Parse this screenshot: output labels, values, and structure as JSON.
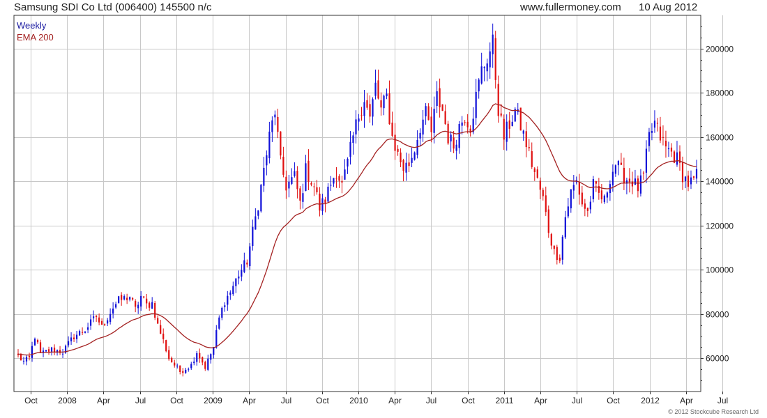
{
  "header": {
    "title": "Samsung SDI Co Ltd (006400) 145500 n/c",
    "site": "www.fullermoney.com",
    "date": "10 Aug 2012"
  },
  "legend": {
    "weekly": "Weekly",
    "ema": "EMA 200"
  },
  "copyright": "© 2012 Stockcube Research Ltd",
  "colors": {
    "up": "#1010d8",
    "down": "#e01010",
    "ema": "#a42222",
    "grid": "#c8c8c8"
  },
  "chart_data": {
    "type": "candlestick",
    "ylim": [
      45000,
      215000
    ],
    "y_ticks": [
      60000,
      80000,
      100000,
      120000,
      140000,
      160000,
      180000,
      200000
    ],
    "x_ticks": [
      "Oct",
      "2008",
      "Apr",
      "Jul",
      "Oct",
      "2009",
      "Apr",
      "Jul",
      "Oct",
      "2010",
      "Apr",
      "Jul",
      "Oct",
      "2011",
      "Apr",
      "Jul",
      "Oct",
      "2012",
      "Apr",
      "Jul"
    ],
    "anchors": [
      [
        0,
        61000
      ],
      [
        2,
        58500
      ],
      [
        4,
        60000
      ],
      [
        6,
        70000
      ],
      [
        8,
        62000
      ],
      [
        12,
        64000
      ],
      [
        16,
        63000
      ],
      [
        20,
        70000
      ],
      [
        24,
        73000
      ],
      [
        28,
        79000
      ],
      [
        30,
        74000
      ],
      [
        34,
        83000
      ],
      [
        36,
        86000
      ],
      [
        40,
        88000
      ],
      [
        42,
        82000
      ],
      [
        44,
        88000
      ],
      [
        46,
        84000
      ],
      [
        48,
        85000
      ],
      [
        50,
        75000
      ],
      [
        52,
        68000
      ],
      [
        54,
        60000
      ],
      [
        56,
        57000
      ],
      [
        58,
        54000
      ],
      [
        62,
        57000
      ],
      [
        64,
        63000
      ],
      [
        67,
        56000
      ],
      [
        70,
        65000
      ],
      [
        72,
        78000
      ],
      [
        74,
        86000
      ],
      [
        76,
        90000
      ],
      [
        79,
        98000
      ],
      [
        82,
        104000
      ],
      [
        86,
        130000
      ],
      [
        88,
        145000
      ],
      [
        90,
        160000
      ],
      [
        92,
        172000
      ],
      [
        94,
        148000
      ],
      [
        96,
        138000
      ],
      [
        99,
        142000
      ],
      [
        101,
        130000
      ],
      [
        103,
        145000
      ],
      [
        106,
        138000
      ],
      [
        108,
        128000
      ],
      [
        110,
        132000
      ],
      [
        112,
        139000
      ],
      [
        114,
        145000
      ],
      [
        116,
        138000
      ],
      [
        118,
        148000
      ],
      [
        120,
        160000
      ],
      [
        122,
        170000
      ],
      [
        124,
        178000
      ],
      [
        126,
        168000
      ],
      [
        128,
        183000
      ],
      [
        130,
        172000
      ],
      [
        132,
        178000
      ],
      [
        134,
        160000
      ],
      [
        136,
        152000
      ],
      [
        138,
        146000
      ],
      [
        140,
        148000
      ],
      [
        142,
        155000
      ],
      [
        144,
        165000
      ],
      [
        146,
        170000
      ],
      [
        148,
        162000
      ],
      [
        150,
        178000
      ],
      [
        152,
        172000
      ],
      [
        154,
        160000
      ],
      [
        156,
        156000
      ],
      [
        158,
        165000
      ],
      [
        160,
        170000
      ],
      [
        162,
        165000
      ],
      [
        164,
        178000
      ],
      [
        166,
        190000
      ],
      [
        168,
        196000
      ],
      [
        170,
        202000
      ],
      [
        172,
        173000
      ],
      [
        174,
        160000
      ],
      [
        176,
        166000
      ],
      [
        178,
        172000
      ],
      [
        180,
        165000
      ],
      [
        182,
        157000
      ],
      [
        184,
        148000
      ],
      [
        186,
        140000
      ],
      [
        188,
        132000
      ],
      [
        190,
        118000
      ],
      [
        192,
        108000
      ],
      [
        194,
        106000
      ],
      [
        196,
        124000
      ],
      [
        198,
        135000
      ],
      [
        200,
        140000
      ],
      [
        202,
        130000
      ],
      [
        204,
        126000
      ],
      [
        206,
        138000
      ],
      [
        208,
        134000
      ],
      [
        210,
        131000
      ],
      [
        212,
        142000
      ],
      [
        214,
        148000
      ],
      [
        216,
        144000
      ],
      [
        218,
        141000
      ],
      [
        220,
        140000
      ],
      [
        222,
        137000
      ],
      [
        224,
        142000
      ],
      [
        226,
        160000
      ],
      [
        228,
        166000
      ],
      [
        230,
        160000
      ],
      [
        232,
        155000
      ],
      [
        234,
        153000
      ],
      [
        236,
        150000
      ],
      [
        238,
        143000
      ],
      [
        240,
        139000
      ],
      [
        242,
        140000
      ],
      [
        243,
        145500
      ]
    ]
  }
}
